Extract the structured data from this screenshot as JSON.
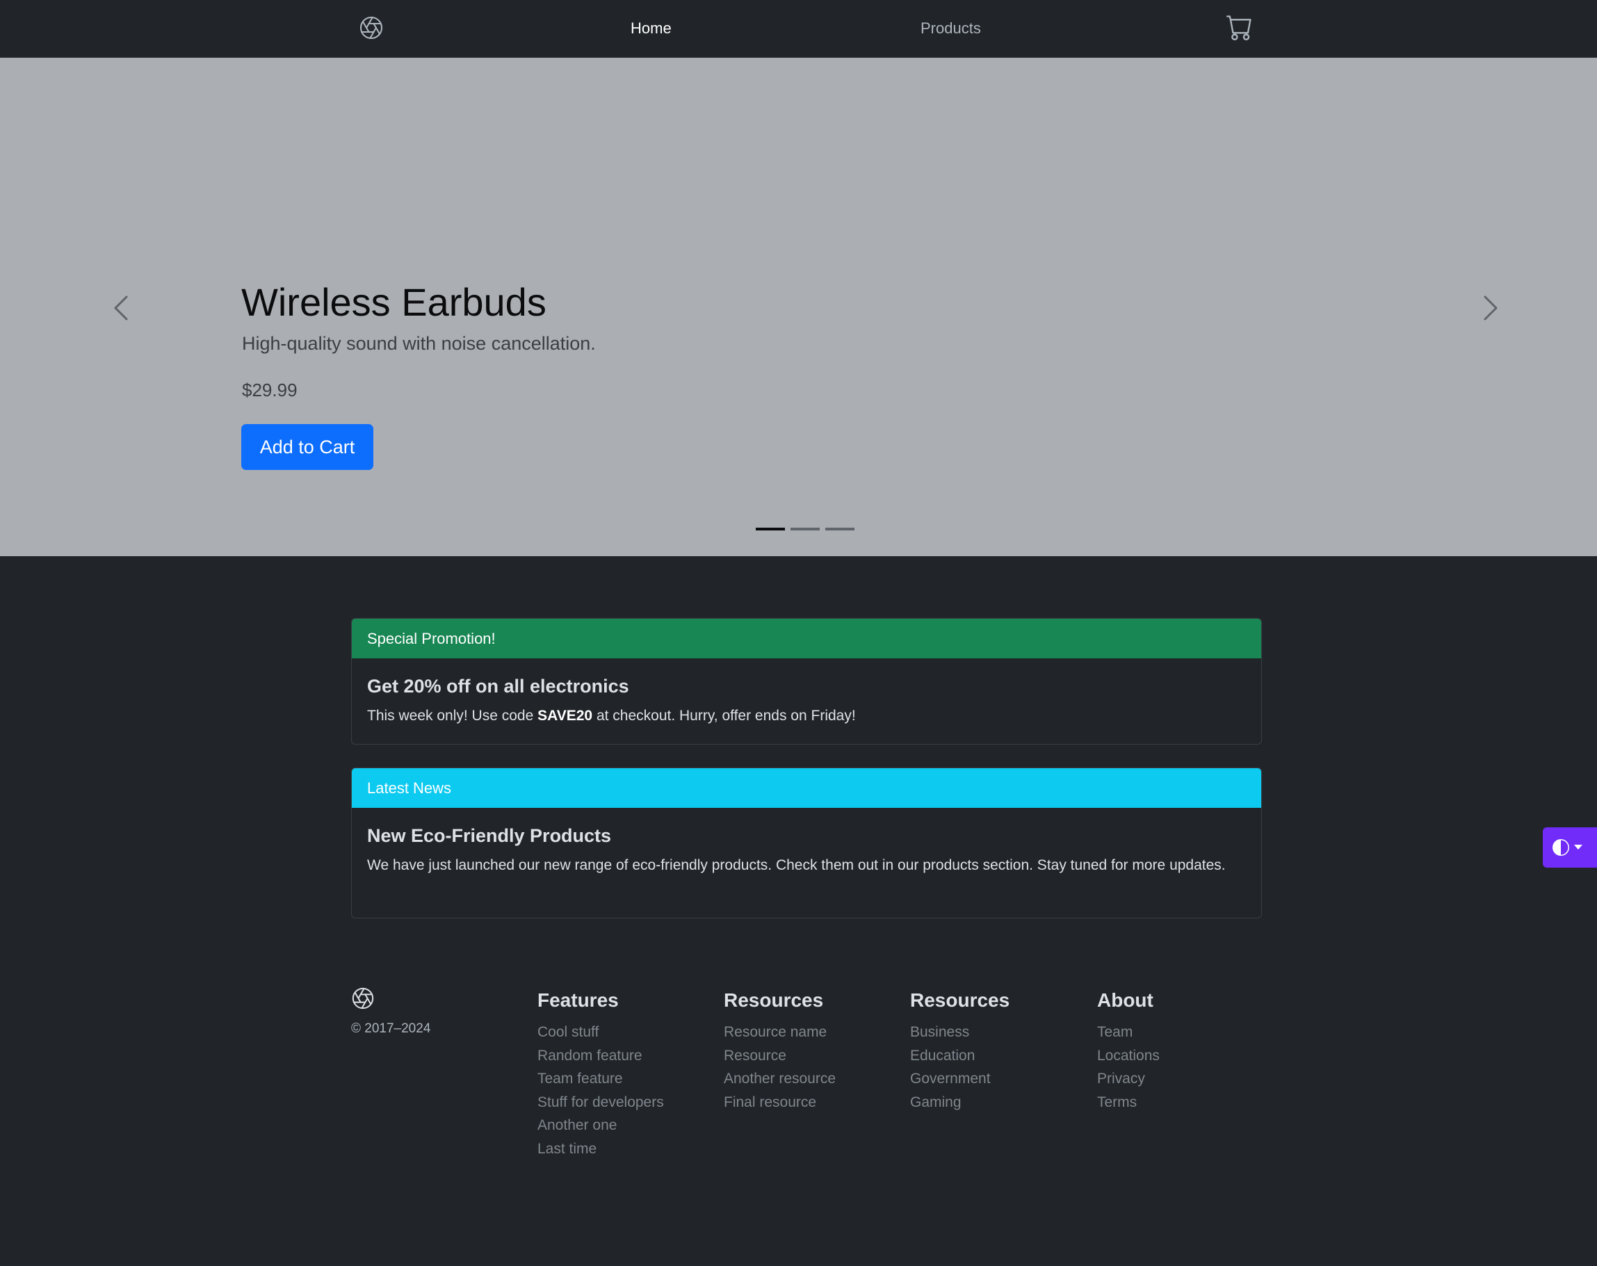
{
  "navbar": {
    "logo_icon": "aperture-icon",
    "home_label": "Home",
    "products_label": "Products",
    "cart_icon": "cart-icon"
  },
  "hero": {
    "title": "Wireless Earbuds",
    "subtitle": "High-quality sound with noise cancellation.",
    "price": "$29.99",
    "button_label": "Add to Cart",
    "slide_count": 3,
    "active_slide": 1
  },
  "promo": {
    "header": "Special Promotion!",
    "title": "Get 20% off on all electronics",
    "text_before": "This week only! Use code ",
    "code": "SAVE20",
    "text_after": " at checkout. Hurry, offer ends on Friday!",
    "color": "#198754"
  },
  "news": {
    "header": "Latest News",
    "title": "New Eco-Friendly Products",
    "text": "We have just launched our new range of eco-friendly products. Check them out in our products section. Stay tuned for more updates.",
    "color": "#0dcaf0"
  },
  "theme_toggle": {
    "icon": "half-circle-icon",
    "color": "#712cf9"
  },
  "footer": {
    "copyright": "© 2017–2024",
    "columns": [
      {
        "title": "Features",
        "links": [
          "Cool stuff",
          "Random feature",
          "Team feature",
          "Stuff for developers",
          "Another one",
          "Last time"
        ]
      },
      {
        "title": "Resources",
        "links": [
          "Resource name",
          "Resource",
          "Another resource",
          "Final resource"
        ]
      },
      {
        "title": "Resources",
        "links": [
          "Business",
          "Education",
          "Government",
          "Gaming"
        ]
      },
      {
        "title": "About",
        "links": [
          "Team",
          "Locations",
          "Privacy",
          "Terms"
        ]
      }
    ]
  }
}
